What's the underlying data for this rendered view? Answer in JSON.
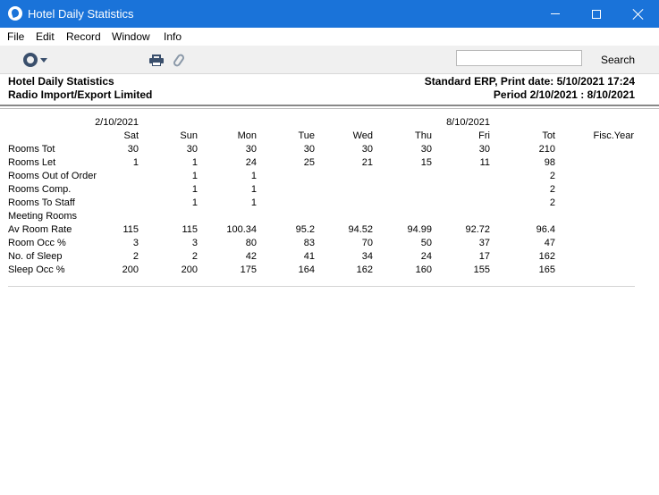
{
  "window": {
    "title": "Hotel Daily Statistics"
  },
  "menu": [
    "File",
    "Edit",
    "Record",
    "Window",
    "Info"
  ],
  "toolbar": {
    "search_label": "Search",
    "search_value": ""
  },
  "report": {
    "title": "Hotel Daily Statistics",
    "company": "Radio Import/Export Limited",
    "print_info": "Standard ERP, Print date: 5/10/2021 17:24",
    "period": "Period  2/10/2021 : 8/10/2021"
  },
  "table": {
    "date_start": "2/10/2021",
    "date_end": "8/10/2021",
    "columns": [
      "Sat",
      "Sun",
      "Mon",
      "Tue",
      "Wed",
      "Thu",
      "Fri",
      "Tot",
      "Fisc.Year"
    ],
    "rows": [
      {
        "label": "Rooms Tot",
        "values": [
          "30",
          "30",
          "30",
          "30",
          "30",
          "30",
          "30",
          "210",
          ""
        ]
      },
      {
        "label": "Rooms Let",
        "values": [
          "1",
          "1",
          "24",
          "25",
          "21",
          "15",
          "11",
          "98",
          ""
        ]
      },
      {
        "label": "Rooms Out of Order",
        "values": [
          "",
          "1",
          "1",
          "",
          "",
          "",
          "",
          "2",
          ""
        ]
      },
      {
        "label": "Rooms Comp.",
        "values": [
          "",
          "1",
          "1",
          "",
          "",
          "",
          "",
          "2",
          ""
        ]
      },
      {
        "label": "Rooms To Staff",
        "values": [
          "",
          "1",
          "1",
          "",
          "",
          "",
          "",
          "2",
          ""
        ]
      },
      {
        "label": "Meeting Rooms",
        "values": [
          "",
          "",
          "",
          "",
          "",
          "",
          "",
          "",
          ""
        ]
      },
      {
        "label": "Av Room Rate",
        "values": [
          "115",
          "115",
          "100.34",
          "95.2",
          "94.52",
          "94.99",
          "92.72",
          "96.4",
          ""
        ]
      },
      {
        "label": "Room Occ %",
        "values": [
          "3",
          "3",
          "80",
          "83",
          "70",
          "50",
          "37",
          "47",
          ""
        ]
      },
      {
        "label": "No. of Sleep",
        "values": [
          "2",
          "2",
          "42",
          "41",
          "34",
          "24",
          "17",
          "162",
          ""
        ]
      },
      {
        "label": "Sleep Occ %",
        "values": [
          "200",
          "200",
          "175",
          "164",
          "162",
          "160",
          "155",
          "165",
          ""
        ]
      }
    ]
  }
}
